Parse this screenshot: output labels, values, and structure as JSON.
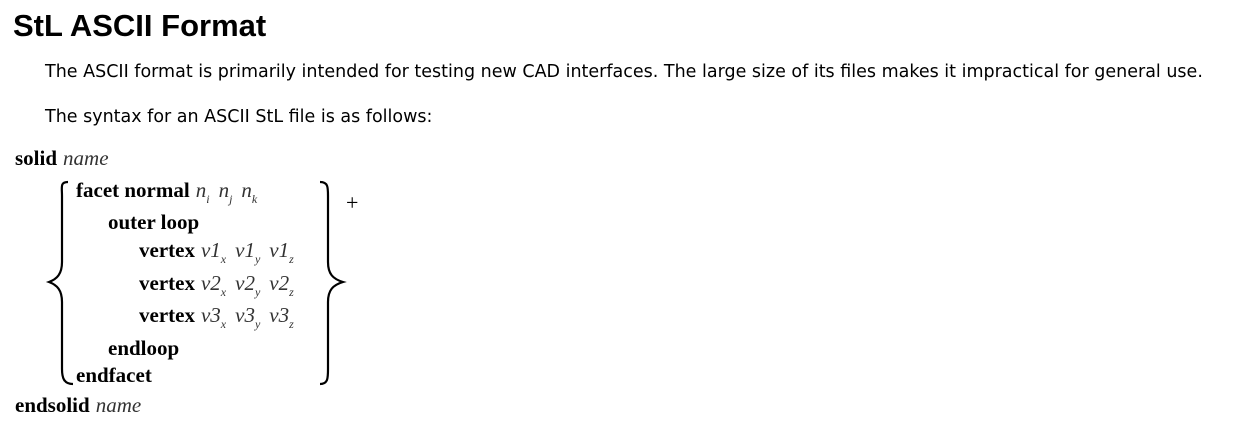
{
  "heading": "StL ASCII Format",
  "paragraphs": {
    "intro": "The ASCII format is primarily intended for testing new CAD interfaces. The large size of its files makes it impractical for general use.",
    "syntax_intro": "The syntax for an ASCII StL file is as follows:"
  },
  "syntax": {
    "solid_keyword": "solid",
    "solid_name": "name",
    "facet_keyword": "facet normal",
    "normal_var": "n",
    "normal_subscripts": [
      "i",
      "j",
      "k"
    ],
    "outer_loop_keyword": "outer loop",
    "vertex_keyword": "vertex",
    "vertices": [
      {
        "base": "v1",
        "subscripts": [
          "x",
          "y",
          "z"
        ]
      },
      {
        "base": "v2",
        "subscripts": [
          "x",
          "y",
          "z"
        ]
      },
      {
        "base": "v3",
        "subscripts": [
          "x",
          "y",
          "z"
        ]
      }
    ],
    "endloop_keyword": "endloop",
    "endfacet_keyword": "endfacet",
    "endsolid_keyword": "endsolid",
    "endsolid_name": "name",
    "repeat_symbol": "+"
  }
}
